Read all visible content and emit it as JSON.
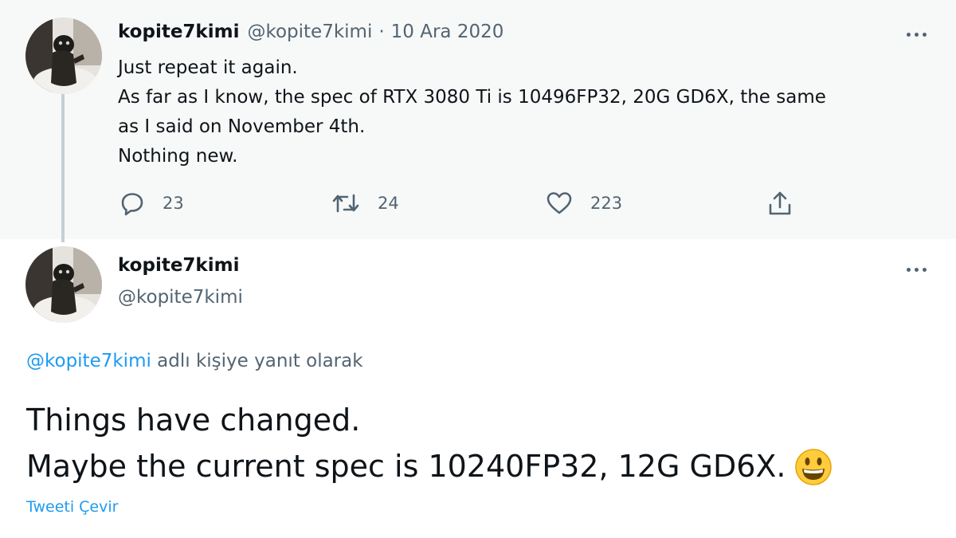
{
  "tweet1": {
    "display_name": "kopite7kimi",
    "handle": "@kopite7kimi",
    "separator": "·",
    "date": "10 Ara 2020",
    "lines": [
      "Just repeat it again.",
      "As far as I know, the spec of RTX 3080 Ti is 10496FP32, 20G GD6X, the same",
      "as I said on November 4th.",
      "Nothing new."
    ],
    "actions": {
      "reply": {
        "icon": "reply-icon",
        "count": "23"
      },
      "retweet": {
        "icon": "retweet-icon",
        "count": "24"
      },
      "like": {
        "icon": "heart-icon",
        "count": "223"
      },
      "share": {
        "icon": "share-icon"
      }
    }
  },
  "tweet2": {
    "display_name": "kopite7kimi",
    "handle": "@kopite7kimi",
    "reply_to_handle": "@kopite7kimi",
    "reply_context": " adlı kişiye yanıt olarak",
    "lines": [
      "Things have changed.",
      "Maybe the current spec is 10240FP32, 12G GD6X."
    ],
    "emoji": "smiley-emoji",
    "translate_label": "Tweeti Çevir"
  },
  "colors": {
    "text": "#0f1419",
    "secondary": "#536471",
    "link": "#1d9bf0",
    "thread_bg": "#f7f9f9",
    "thread_line": "#c4cfd6"
  }
}
